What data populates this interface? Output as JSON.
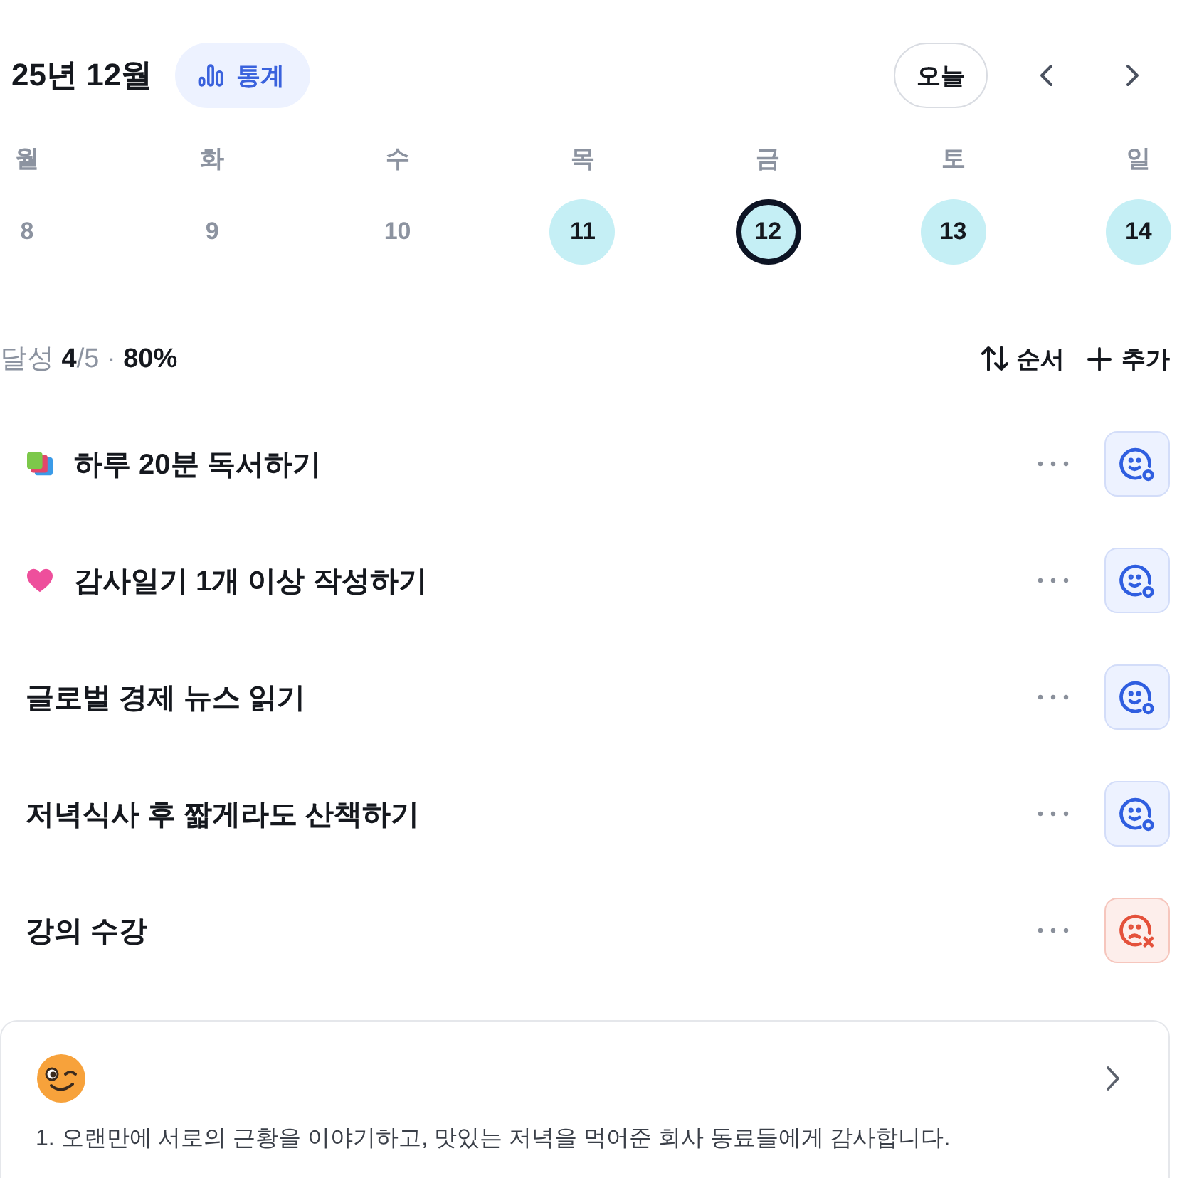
{
  "header": {
    "title": "25년 12월",
    "stats_button": "통계",
    "today_button": "오늘"
  },
  "week": [
    {
      "weekday": "월",
      "day": "8",
      "marked": false,
      "selected": false
    },
    {
      "weekday": "화",
      "day": "9",
      "marked": false,
      "selected": false
    },
    {
      "weekday": "수",
      "day": "10",
      "marked": false,
      "selected": false
    },
    {
      "weekday": "목",
      "day": "11",
      "marked": true,
      "selected": false
    },
    {
      "weekday": "금",
      "day": "12",
      "marked": true,
      "selected": true
    },
    {
      "weekday": "토",
      "day": "13",
      "marked": true,
      "selected": false
    },
    {
      "weekday": "일",
      "day": "14",
      "marked": true,
      "selected": false
    }
  ],
  "summary": {
    "text": "달성 **4**/5 · **80%**",
    "sort_button": "순서",
    "add_button": "추가"
  },
  "habits": [
    {
      "kind": "book",
      "title": "하루 20분 독서하기",
      "done": true
    },
    {
      "kind": "heart",
      "title": "감사일기 1개 이상 작성하기",
      "done": true
    },
    {
      "kind": "plain",
      "title": "글로벌 경제 뉴스 읽기",
      "done": true
    },
    {
      "kind": "plain",
      "title": "저녁식사 후 짧게라도 산책하기",
      "done": true
    },
    {
      "kind": "plain",
      "title": "강의 수강",
      "done": false
    }
  ],
  "entry": {
    "text": "1. 오랜만에 서로의 근황을 이야기하고, 맛있는 저녁을 먹어준 회사 동료들에게 감사합니다."
  }
}
